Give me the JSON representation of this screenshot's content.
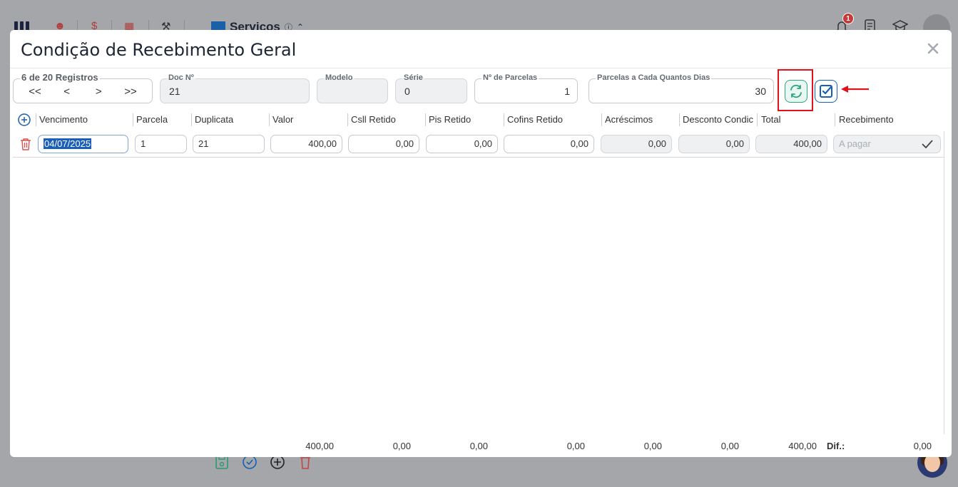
{
  "app": {
    "module_title": "Servicos",
    "module_info_icon": "info-circle-icon",
    "notification_count": "1"
  },
  "modal": {
    "title": "Condição de Recebimento Geral",
    "close_label": "×"
  },
  "form": {
    "navigator": {
      "label": "6 de 20 Registros",
      "first": "<<",
      "prev": "<",
      "next": ">",
      "last": ">>"
    },
    "doc_no": {
      "label": "Doc Nº",
      "value": "21"
    },
    "modelo": {
      "label": "Modelo",
      "value": ""
    },
    "serie": {
      "label": "Série",
      "value": "0"
    },
    "num_parcelas": {
      "label": "Nº de Parcelas",
      "value": "1"
    },
    "parcelas_dias": {
      "label": "Parcelas a Cada Quantos Dias",
      "value": "30"
    }
  },
  "table": {
    "headers": {
      "vencimento": "Vencimento",
      "parcela": "Parcela",
      "duplicata": "Duplicata",
      "valor": "Valor",
      "csll": "Csll Retido",
      "pis": "Pis Retido",
      "cofins": "Cofins Retido",
      "acrescimos": "Acréscimos",
      "desconto": "Desconto Condic",
      "total": "Total",
      "recebimento": "Recebimento"
    },
    "rows": [
      {
        "vencimento": "04/07/2025",
        "parcela": "1",
        "duplicata": "21",
        "valor": "400,00",
        "csll": "0,00",
        "pis": "0,00",
        "cofins": "0,00",
        "acrescimos": "0,00",
        "desconto": "0,00",
        "total": "400,00",
        "recebimento_placeholder": "A pagar"
      }
    ],
    "footer": {
      "valor": "400,00",
      "csll": "0,00",
      "pis": "0,00",
      "cofins": "0,00",
      "acrescimos": "0,00",
      "desconto": "0,00",
      "total": "400,00",
      "dif_label": "Dif.:",
      "dif_value": "0,00"
    }
  },
  "colors": {
    "highlight": "#e0131d",
    "refresh": "#27a57d",
    "confirm": "#1660b6",
    "danger": "#d9534f"
  }
}
